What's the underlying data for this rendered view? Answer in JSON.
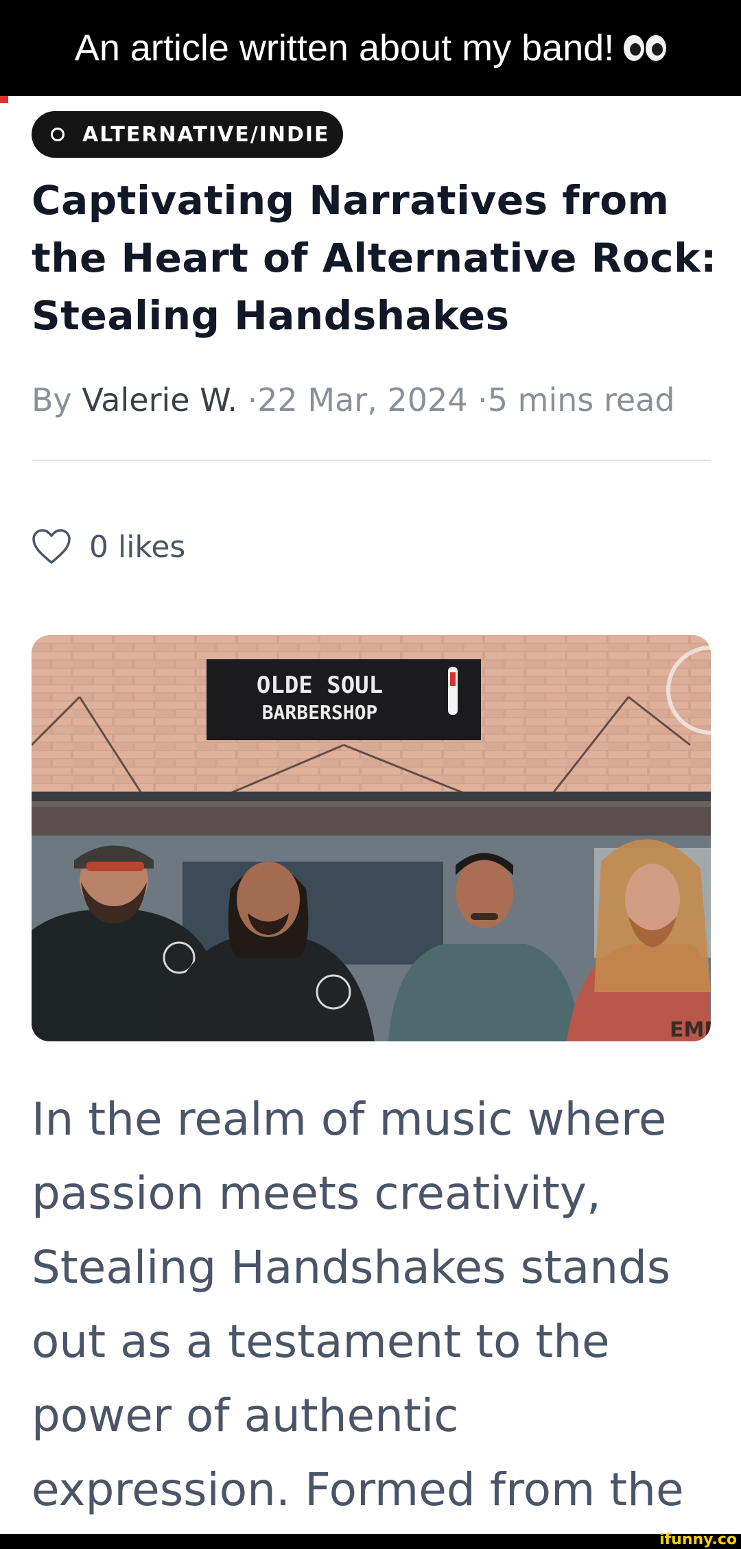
{
  "caption": {
    "text": "An article written about my band!",
    "emoji": "eyes-emoji"
  },
  "article": {
    "category": "ALTERNATIVE/INDIE",
    "title": "Captivating Narratives from the Heart of Alternative Rock: Stealing Handshakes",
    "byline": {
      "prefix": "By",
      "author": "Valerie W.",
      "date": "·22 Mar, 2024",
      "read_time": "·5 mins read"
    },
    "likes": {
      "count_label": "0 likes",
      "icon": "heart-outline-icon"
    },
    "image": {
      "sign_line1": "OLDE SOUL",
      "sign_line2": "BARBERSHOP",
      "shirt_text": "EME"
    },
    "body": "In the realm of music where passion meets creativity, Stealing Handshakes stands out as a testament to the power of authentic expression. Formed from the"
  },
  "watermark": "ifunny.co",
  "colors": {
    "pill_bg": "#151515",
    "title": "#111827",
    "body": "#4a5568",
    "meta": "#8a9099"
  }
}
